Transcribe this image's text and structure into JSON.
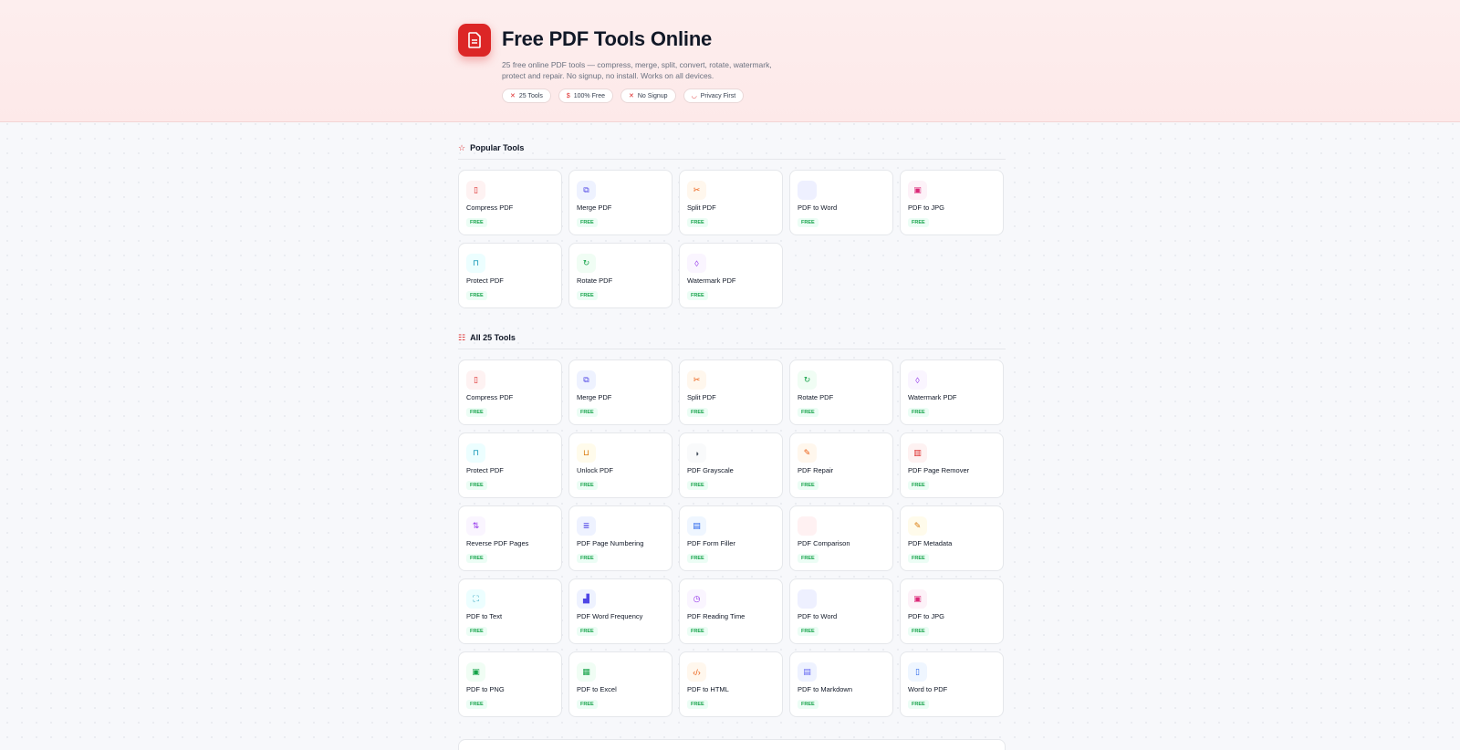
{
  "hero": {
    "title": "Free PDF Tools Online",
    "description": "25 free online PDF tools — compress, merge, split, convert, rotate, watermark, protect and repair. No signup, no install. Works on all devices.",
    "pills": [
      {
        "label": "25 Tools",
        "icon": "✕"
      },
      {
        "label": "100% Free",
        "icon": "$"
      },
      {
        "label": "No Signup",
        "icon": "✕"
      },
      {
        "label": "Privacy First",
        "icon": "◡"
      }
    ]
  },
  "popular": {
    "title": "Popular Tools",
    "items": [
      {
        "name": "Compress PDF",
        "badge": "FREE",
        "glyph": "▯",
        "color": "#dc2626",
        "bg": "#fef2f2"
      },
      {
        "name": "Merge PDF",
        "badge": "FREE",
        "glyph": "⧉",
        "color": "#4f46e5",
        "bg": "#eef2ff"
      },
      {
        "name": "Split PDF",
        "badge": "FREE",
        "glyph": "✂",
        "color": "#ea580c",
        "bg": "#fff7ed"
      },
      {
        "name": "PDF to Word",
        "badge": "FREE",
        "glyph": "",
        "color": "#6366f1",
        "bg": "#eef0ff"
      },
      {
        "name": "PDF to JPG",
        "badge": "FREE",
        "glyph": "▣",
        "color": "#db2777",
        "bg": "#fdf2f8"
      },
      {
        "name": "Protect PDF",
        "badge": "FREE",
        "glyph": "⊓",
        "color": "#0891b2",
        "bg": "#ecfeff"
      },
      {
        "name": "Rotate PDF",
        "badge": "FREE",
        "glyph": "↻",
        "color": "#16a34a",
        "bg": "#f0fdf4"
      },
      {
        "name": "Watermark PDF",
        "badge": "FREE",
        "glyph": "◊",
        "color": "#9333ea",
        "bg": "#faf5ff"
      }
    ]
  },
  "all": {
    "title": "All 25 Tools",
    "items": [
      {
        "name": "Compress PDF",
        "badge": "FREE",
        "glyph": "▯",
        "color": "#dc2626",
        "bg": "#fef2f2"
      },
      {
        "name": "Merge PDF",
        "badge": "FREE",
        "glyph": "⧉",
        "color": "#4f46e5",
        "bg": "#eef2ff"
      },
      {
        "name": "Split PDF",
        "badge": "FREE",
        "glyph": "✂",
        "color": "#ea580c",
        "bg": "#fff7ed"
      },
      {
        "name": "Rotate PDF",
        "badge": "FREE",
        "glyph": "↻",
        "color": "#16a34a",
        "bg": "#f0fdf4"
      },
      {
        "name": "Watermark PDF",
        "badge": "FREE",
        "glyph": "◊",
        "color": "#9333ea",
        "bg": "#faf5ff"
      },
      {
        "name": "Protect PDF",
        "badge": "FREE",
        "glyph": "⊓",
        "color": "#0891b2",
        "bg": "#ecfeff"
      },
      {
        "name": "Unlock PDF",
        "badge": "FREE",
        "glyph": "⊔",
        "color": "#d97706",
        "bg": "#fffbeb"
      },
      {
        "name": "PDF Grayscale",
        "badge": "FREE",
        "glyph": "◑",
        "color": "#4b5563",
        "bg": "#f9fafb"
      },
      {
        "name": "PDF Repair",
        "badge": "FREE",
        "glyph": "✎",
        "color": "#ea580c",
        "bg": "#fff7ed"
      },
      {
        "name": "PDF Page Remover",
        "badge": "FREE",
        "glyph": "▥",
        "color": "#dc2626",
        "bg": "#fef2f2"
      },
      {
        "name": "Reverse PDF Pages",
        "badge": "FREE",
        "glyph": "⇅",
        "color": "#9333ea",
        "bg": "#faf5ff"
      },
      {
        "name": "PDF Page Numbering",
        "badge": "FREE",
        "glyph": "≣",
        "color": "#4f46e5",
        "bg": "#eef2ff"
      },
      {
        "name": "PDF Form Filler",
        "badge": "FREE",
        "glyph": "▤",
        "color": "#2563eb",
        "bg": "#eff6ff"
      },
      {
        "name": "PDF Comparison",
        "badge": "FREE",
        "glyph": "",
        "color": "#e11d48",
        "bg": "#fff1f2"
      },
      {
        "name": "PDF Metadata",
        "badge": "FREE",
        "glyph": "✎",
        "color": "#d97706",
        "bg": "#fffbeb"
      },
      {
        "name": "PDF to Text",
        "badge": "FREE",
        "glyph": "⛶",
        "color": "#0891b2",
        "bg": "#ecfeff"
      },
      {
        "name": "PDF Word Frequency",
        "badge": "FREE",
        "glyph": "▟",
        "color": "#4f46e5",
        "bg": "#eef2ff"
      },
      {
        "name": "PDF Reading Time",
        "badge": "FREE",
        "glyph": "◷",
        "color": "#9333ea",
        "bg": "#faf5ff"
      },
      {
        "name": "PDF to Word",
        "badge": "FREE",
        "glyph": "",
        "color": "#6366f1",
        "bg": "#eef0ff"
      },
      {
        "name": "PDF to JPG",
        "badge": "FREE",
        "glyph": "▣",
        "color": "#db2777",
        "bg": "#fdf2f8"
      },
      {
        "name": "PDF to PNG",
        "badge": "FREE",
        "glyph": "▣",
        "color": "#16a34a",
        "bg": "#f0fdf4"
      },
      {
        "name": "PDF to Excel",
        "badge": "FREE",
        "glyph": "▦",
        "color": "#16a34a",
        "bg": "#f0fdf4"
      },
      {
        "name": "PDF to HTML",
        "badge": "FREE",
        "glyph": "‹/›",
        "color": "#ea580c",
        "bg": "#fff7ed"
      },
      {
        "name": "PDF to Markdown",
        "badge": "FREE",
        "glyph": "▤",
        "color": "#6366f1",
        "bg": "#eef2ff"
      },
      {
        "name": "Word to PDF",
        "badge": "FREE",
        "glyph": "▯",
        "color": "#2563eb",
        "bg": "#eff6ff"
      }
    ]
  }
}
